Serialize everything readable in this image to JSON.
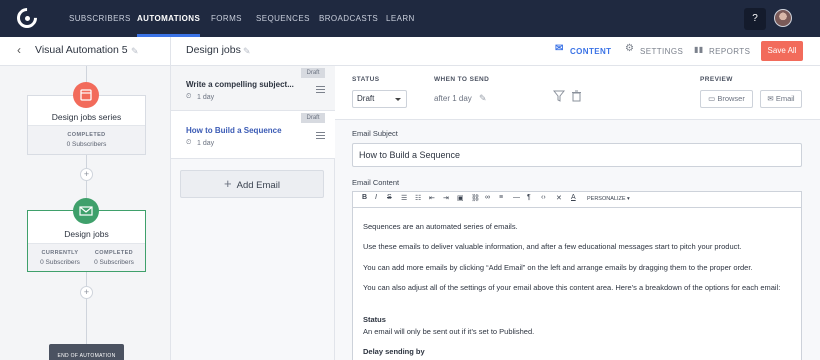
{
  "nav": {
    "items": [
      {
        "label": "SUBSCRIBERS",
        "active": false
      },
      {
        "label": "AUTOMATIONS",
        "active": true
      },
      {
        "label": "FORMS",
        "active": false
      },
      {
        "label": "SEQUENCES",
        "active": false
      },
      {
        "label": "BROADCASTS",
        "active": false
      },
      {
        "label": "LEARN",
        "active": false
      }
    ],
    "help_label": "?"
  },
  "automation": {
    "title": "Visual Automation 5",
    "nodes": [
      {
        "title": "Design jobs series",
        "stats": [
          {
            "label": "COMPLETED",
            "value": "0 Subscribers"
          }
        ],
        "color": "#f26b5b"
      },
      {
        "title": "Design jobs",
        "stats": [
          {
            "label": "CURRENTLY",
            "value": "0 Subscribers"
          },
          {
            "label": "COMPLETED",
            "value": "0 Subscribers"
          }
        ],
        "color": "#3fa06b"
      }
    ],
    "end_label": "END OF AUTOMATION",
    "plus_label": "+"
  },
  "sequence": {
    "title": "Design jobs",
    "emails": [
      {
        "title": "Write a compelling subject...",
        "delay": "1 day",
        "badge": "Draft",
        "selected": false
      },
      {
        "title": "How to Build a Sequence",
        "delay": "1 day",
        "badge": "Draft",
        "selected": true
      }
    ],
    "add_email_label": "Add Email"
  },
  "header": {
    "content": "CONTENT",
    "settings": "SETTINGS",
    "reports": "REPORTS",
    "save_all": "Save All"
  },
  "email_settings": {
    "status_label": "STATUS",
    "status_value": "Draft",
    "when_label": "WHEN TO SEND",
    "when_value": "after 1 day",
    "preview_label": "PREVIEW",
    "browser_label": "Browser",
    "email_label": "Email"
  },
  "editor": {
    "subject_label": "Email Subject",
    "subject_value": "How to Build a Sequence",
    "content_label": "Email Content",
    "personalize_label": "PERSONALIZE",
    "paragraphs": [
      {
        "text": "Sequences are an automated series of emails.",
        "bold": false
      },
      {
        "text": "Use these emails to deliver valuable information, and after a few educational messages start to pitch your product.",
        "bold": false
      },
      {
        "text": "You can add more emails by clicking “Add Email” on the left and arrange emails by dragging them to the proper order.",
        "bold": false
      },
      {
        "text": "You can also adjust all of the settings of your email above this content area. Here’s a breakdown of the options for each email:",
        "bold": false
      },
      {
        "text": "Status",
        "bold": true
      },
      {
        "text": "An email will only be sent out if it’s set to Published.",
        "bold": false
      },
      {
        "text": "Delay sending by",
        "bold": true
      }
    ]
  },
  "colors": {
    "nav_bg": "#1f2940",
    "accent": "#3b73e6",
    "save": "#f26b5b",
    "email_node": "#3fa06b"
  }
}
